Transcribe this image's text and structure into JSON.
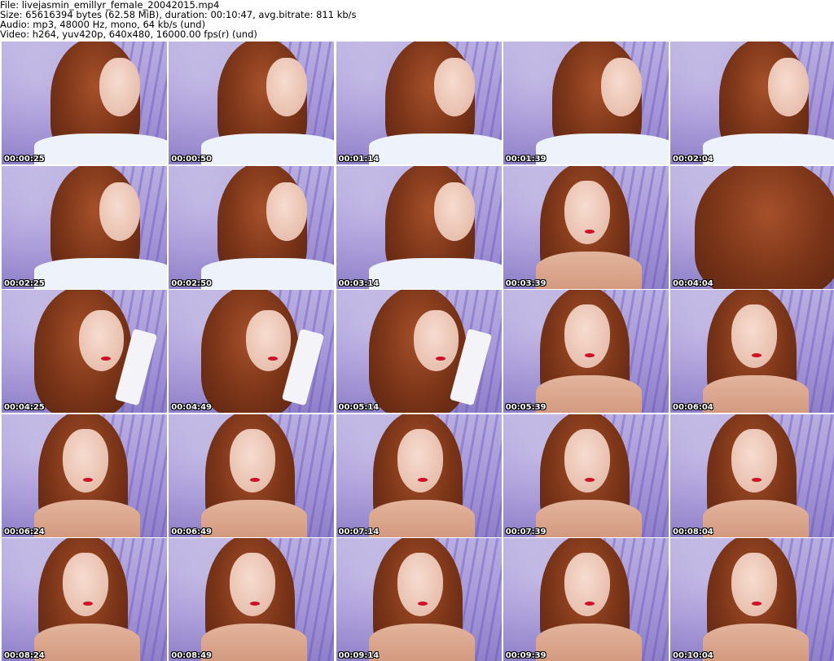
{
  "header": {
    "line1": "File: livejasmin_emillyr_female_20042015.mp4",
    "line2": "Size: 65616394 bytes (62.58 MiB), duration: 00:10:47, avg.bitrate: 811 kb/s",
    "line3": "Audio: mp3, 48000 Hz, mono, 64 kb/s (und)",
    "line4": "Video: h264, yuv420p, 640x480, 16000.00 fps(r) (und)"
  },
  "thumbnails": [
    {
      "time": "00:00:25"
    },
    {
      "time": "00:00:50"
    },
    {
      "time": "00:01:14"
    },
    {
      "time": "00:01:39"
    },
    {
      "time": "00:02:04"
    },
    {
      "time": "00:02:25"
    },
    {
      "time": "00:02:50"
    },
    {
      "time": "00:03:14"
    },
    {
      "time": "00:03:39"
    },
    {
      "time": "00:04:04"
    },
    {
      "time": "00:04:25"
    },
    {
      "time": "00:04:49"
    },
    {
      "time": "00:05:14"
    },
    {
      "time": "00:05:39"
    },
    {
      "time": "00:06:04"
    },
    {
      "time": "00:06:24"
    },
    {
      "time": "00:06:49"
    },
    {
      "time": "00:07:14"
    },
    {
      "time": "00:07:39"
    },
    {
      "time": "00:08:04"
    },
    {
      "time": "00:08:24"
    },
    {
      "time": "00:08:49"
    },
    {
      "time": "00:09:14"
    },
    {
      "time": "00:09:39"
    },
    {
      "time": "00:10:04"
    }
  ],
  "colors": {
    "background": "#ffffff",
    "wall": "#b2a5dc",
    "hair": "#7a3418",
    "lips": "#d0102a",
    "timestamp_text": "#ffffff"
  }
}
